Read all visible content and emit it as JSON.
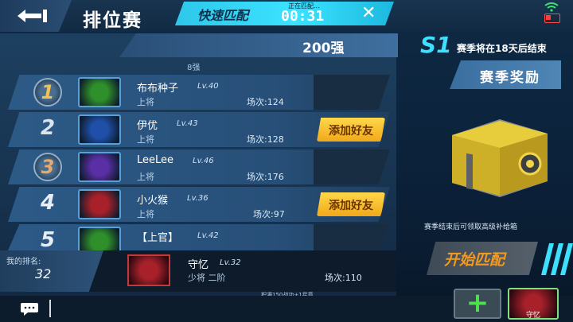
{
  "header": {
    "title": "排位赛",
    "quick_match": {
      "label": "快速匹配",
      "status": "正在匹配...",
      "timer": "00:31",
      "close": "✕"
    }
  },
  "leaderboard": {
    "tier": "200强",
    "subheader": "8强",
    "rows": [
      {
        "rank": "1",
        "name": "布布种子",
        "level": "Lv.40",
        "rank_name": "上将",
        "matches": "场次:124",
        "avatar_color": "#2f8f2a",
        "rank_color": "#f2c14e",
        "add_friend": ""
      },
      {
        "rank": "2",
        "name": "伊优",
        "level": "Lv.43",
        "rank_name": "上将",
        "matches": "场次:128",
        "avatar_color": "#1f4fa8",
        "rank_color": "#d9e4ef",
        "add_friend": "添加好友"
      },
      {
        "rank": "3",
        "name": "LeeLee",
        "level": "Lv.46",
        "rank_name": "上将",
        "matches": "场次:176",
        "avatar_color": "#5a2fa6",
        "rank_color": "#e8a86b",
        "add_friend": ""
      },
      {
        "rank": "4",
        "name": "小火猴",
        "level": "Lv.36",
        "rank_name": "上将",
        "matches": "场次:97",
        "avatar_color": "#a8212a",
        "rank_color": "#e8eef5",
        "add_friend": "添加好友"
      },
      {
        "rank": "5",
        "name": "【上官】",
        "level": "Lv.42",
        "rank_name": "",
        "matches": "",
        "avatar_color": "#2f8f2a",
        "rank_color": "#e8eef5",
        "add_friend": ""
      }
    ]
  },
  "my_rank": {
    "label": "我的排名:",
    "rank": "32",
    "name": "守忆",
    "level": "Lv.32",
    "rank_name": "少将 二阶",
    "matches": "场次:110",
    "note": "积满150战功+1星章"
  },
  "season": {
    "season_id": "S1",
    "ends_text": "赛季将在18天后结束",
    "reward_tab": "赛季奖励",
    "chest_note": "赛季结束后可领取高级补给箱",
    "start_button": "开始匹配"
  },
  "bottom": {
    "plus": "+",
    "party_name": "守忆"
  },
  "colors": {
    "accent": "#3de0ff",
    "button_yellow": "#f5c231",
    "start_text": "#f39a1d"
  }
}
